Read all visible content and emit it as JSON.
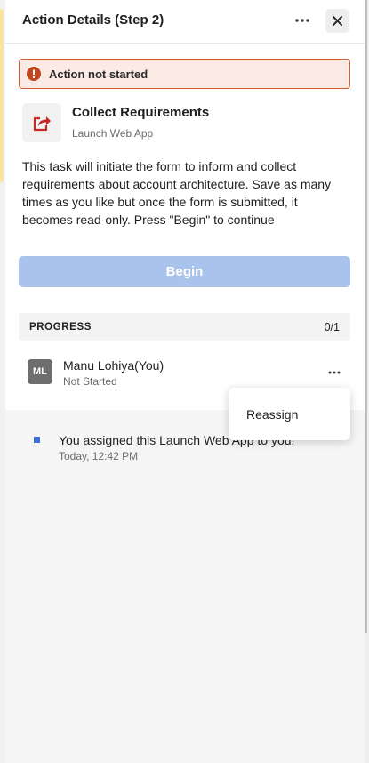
{
  "header": {
    "title": "Action Details (Step 2)",
    "more_icon": "more-horizontal-icon",
    "close_icon": "close-icon"
  },
  "banner": {
    "text": "Action not started",
    "icon": "info-icon",
    "color": "#d55a34",
    "background": "#fbe9e3"
  },
  "task": {
    "title": "Collect Requirements",
    "subtitle": "Launch Web App",
    "icon": "share-icon",
    "icon_color": "#c62828"
  },
  "description": "This task will initiate the form to inform and collect requirements about account architecture. Save as many times as you like but once the form is submitted, it becomes read-only. Press \"Begin\" to continue",
  "begin_button": {
    "label": "Begin",
    "color": "#a9c3ec"
  },
  "progress": {
    "label": "PROGRESS",
    "count": "0/1"
  },
  "assignee": {
    "initials": "ML",
    "name": "Manu Lohiya(You)",
    "status": "Not Started"
  },
  "menu": {
    "items": [
      {
        "label": "Reassign"
      }
    ]
  },
  "activity": [
    {
      "text": "You assigned this Launch Web App to you.",
      "time": "Today, 12:42 PM",
      "marker_color": "#3b6fd6"
    }
  ]
}
